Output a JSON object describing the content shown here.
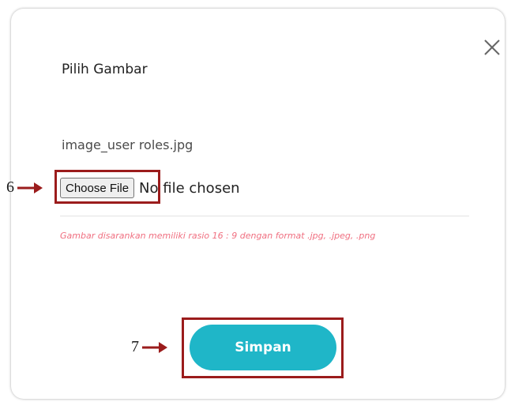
{
  "dialog": {
    "title": "Pilih Gambar",
    "current_filename": "image_user roles.jpg",
    "file_input": {
      "button_label": "Choose File",
      "status": "No file chosen"
    },
    "hint": "Gambar disarankan memiliki  rasio 16 : 9 dengan format .jpg, .jpeg, .png",
    "save_label": "Simpan",
    "close_icon": "close-icon"
  },
  "annotations": {
    "step_choose": "6",
    "step_save": "7",
    "highlight_color": "#9b1c1c",
    "arrow_icon": "arrow-right-icon"
  },
  "colors": {
    "accent": "#1fb6c8",
    "hint": "#f06f80"
  }
}
